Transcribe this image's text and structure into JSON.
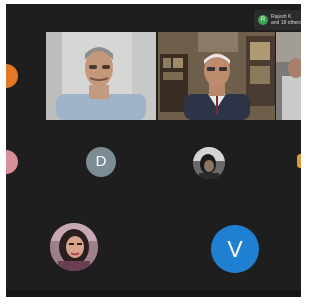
{
  "speaker_chip": {
    "badge": "R",
    "line1": "Rajesh K",
    "line2": "and 18 others"
  },
  "participants": {
    "tile_1": "participant-video-1",
    "tile_2": "participant-video-2",
    "tile_3": "participant-video-3",
    "d_initial": "D",
    "v_initial": "V"
  },
  "colors": {
    "stage_background": "#1e1e1e",
    "avatar_d": "#7b8c95",
    "avatar_v": "#1f7fd0",
    "active_speaker": "#3fa34d",
    "edge_orange": "#e2792a",
    "edge_pink": "#d98f97"
  }
}
